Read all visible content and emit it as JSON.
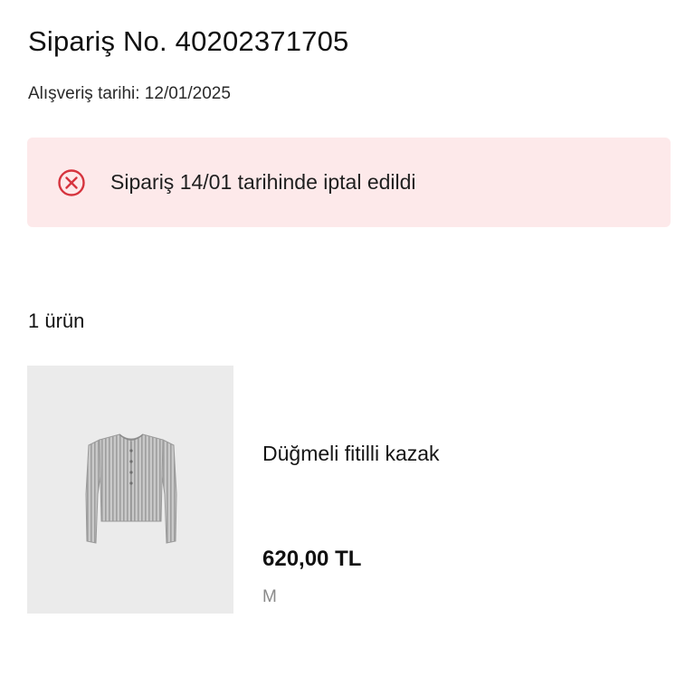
{
  "order": {
    "title": "Sipariş No. 40202371705",
    "date": "Alışveriş tarihi: 12/01/2025"
  },
  "cancel_notice": {
    "icon": "circle-x-icon",
    "message": "Sipariş 14/01 tarihinde iptal edildi",
    "background_color": "#fde9ea",
    "icon_color": "#d6343e"
  },
  "items": {
    "count_label": "1 ürün",
    "list": [
      {
        "name": "Düğmeli fitilli kazak",
        "price": "620,00 TL",
        "size": "M",
        "image": "grey-ribbed-cardigan"
      }
    ]
  }
}
